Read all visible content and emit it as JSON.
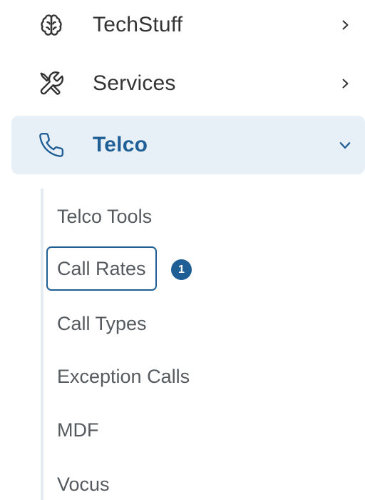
{
  "nav": {
    "items": [
      {
        "label": "TechStuff",
        "icon": "brain-icon",
        "chevron": "chevron-right-icon",
        "expanded": false
      },
      {
        "label": "Services",
        "icon": "tools-icon",
        "chevron": "chevron-right-icon",
        "expanded": false
      },
      {
        "label": "Telco",
        "icon": "phone-icon",
        "chevron": "chevron-down-icon",
        "expanded": true
      }
    ],
    "submenu": [
      {
        "label": "Telco Tools"
      },
      {
        "label": "Call Rates",
        "active": true,
        "badge": "1"
      },
      {
        "label": "Call Types"
      },
      {
        "label": "Exception Calls"
      },
      {
        "label": "MDF"
      },
      {
        "label": "Vocus"
      }
    ]
  },
  "colors": {
    "accent": "#1f5f96",
    "active_bg": "#e7eff7",
    "text": "#333333",
    "subtext": "#555a5f",
    "rail": "#e4ecf4"
  }
}
